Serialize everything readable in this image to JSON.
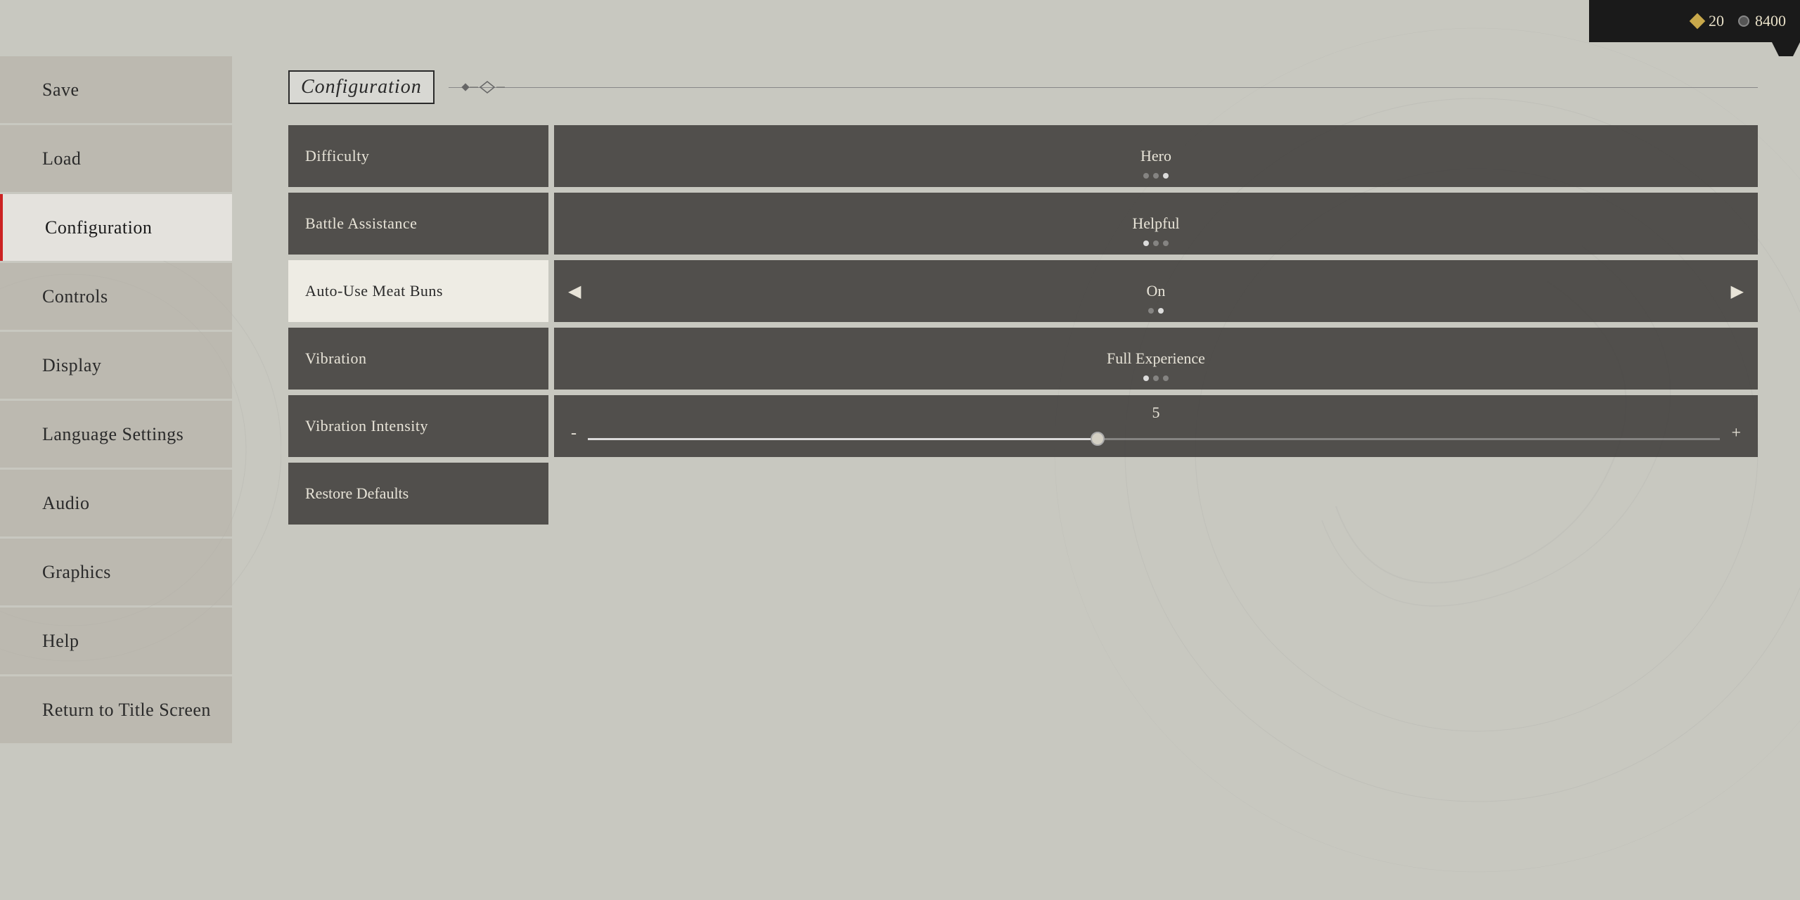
{
  "topbar": {
    "currency1_icon": "diamond",
    "currency1_value": "20",
    "currency2_icon": "circle",
    "currency2_value": "8400"
  },
  "sidebar": {
    "items": [
      {
        "id": "save",
        "label": "Save",
        "active": false
      },
      {
        "id": "load",
        "label": "Load",
        "active": false
      },
      {
        "id": "configuration",
        "label": "Configuration",
        "active": true
      },
      {
        "id": "controls",
        "label": "Controls",
        "active": false
      },
      {
        "id": "display",
        "label": "Display",
        "active": false
      },
      {
        "id": "language-settings",
        "label": "Language Settings",
        "active": false
      },
      {
        "id": "audio",
        "label": "Audio",
        "active": false
      },
      {
        "id": "graphics",
        "label": "Graphics",
        "active": false
      },
      {
        "id": "help",
        "label": "Help",
        "active": false
      },
      {
        "id": "return-to-title",
        "label": "Return to Title Screen",
        "active": false
      }
    ]
  },
  "main": {
    "title": "Configuration",
    "settings": [
      {
        "id": "difficulty",
        "label": "Difficulty",
        "value": "Hero",
        "dots": [
          false,
          false,
          true
        ],
        "type": "value",
        "selected": false
      },
      {
        "id": "battle-assistance",
        "label": "Battle Assistance",
        "value": "Helpful",
        "dots": [
          true,
          false,
          false
        ],
        "type": "value",
        "selected": false
      },
      {
        "id": "auto-use-meat-buns",
        "label": "Auto-Use Meat Buns",
        "value": "On",
        "dots": [
          false,
          true
        ],
        "type": "toggle",
        "selected": true
      },
      {
        "id": "vibration",
        "label": "Vibration",
        "value": "Full Experience",
        "dots": [
          true,
          false,
          false
        ],
        "type": "value",
        "selected": false
      }
    ],
    "slider": {
      "id": "vibration-intensity",
      "label": "Vibration Intensity",
      "value": "5",
      "min_label": "-",
      "max_label": "+",
      "percent": 45
    },
    "restore_button": {
      "label": "Restore Defaults"
    }
  }
}
